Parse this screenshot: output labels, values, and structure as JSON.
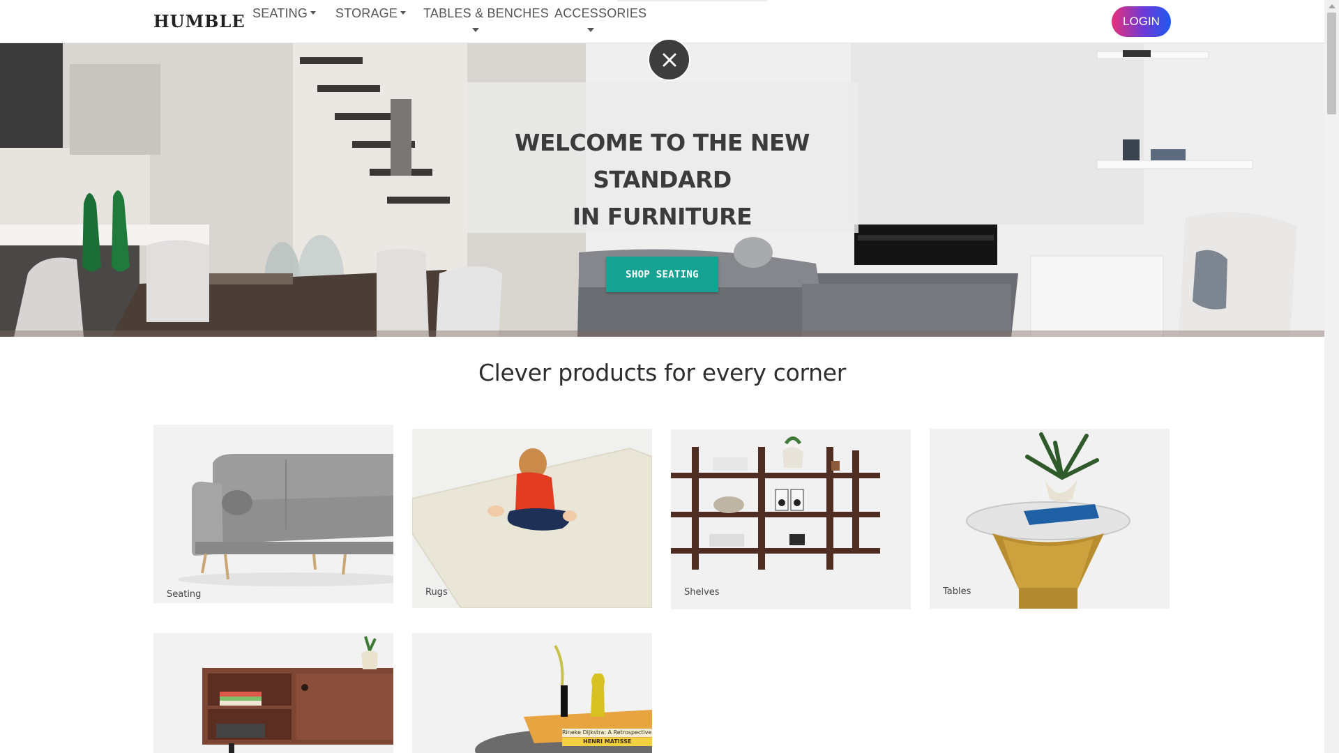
{
  "navbar": {
    "brand": "HUMBLE",
    "items": [
      {
        "label": "SEATING"
      },
      {
        "label": "STORAGE"
      },
      {
        "label": "TABLES & BENCHES"
      },
      {
        "label": "ACCESSORIES"
      }
    ],
    "login_label": "LOGIN"
  },
  "hero": {
    "title_line1": "WELCOME TO THE NEW STANDARD",
    "title_line2": "IN FURNITURE",
    "cta_label": "SHOP SEATING",
    "close_icon": "close-icon"
  },
  "section": {
    "title": "Clever products for every corner"
  },
  "categories": [
    {
      "label": "Seating"
    },
    {
      "label": "Rugs"
    },
    {
      "label": "Shelves"
    },
    {
      "label": "Tables"
    }
  ],
  "product_texts": {
    "book1": "Rineke Dijkstra: A Retrospective",
    "book2": "HENRI MATISSE"
  },
  "colors": {
    "cta_teal": "#16a394",
    "login_gradient_start": "#e6307a",
    "login_gradient_end": "#1f58ef"
  }
}
